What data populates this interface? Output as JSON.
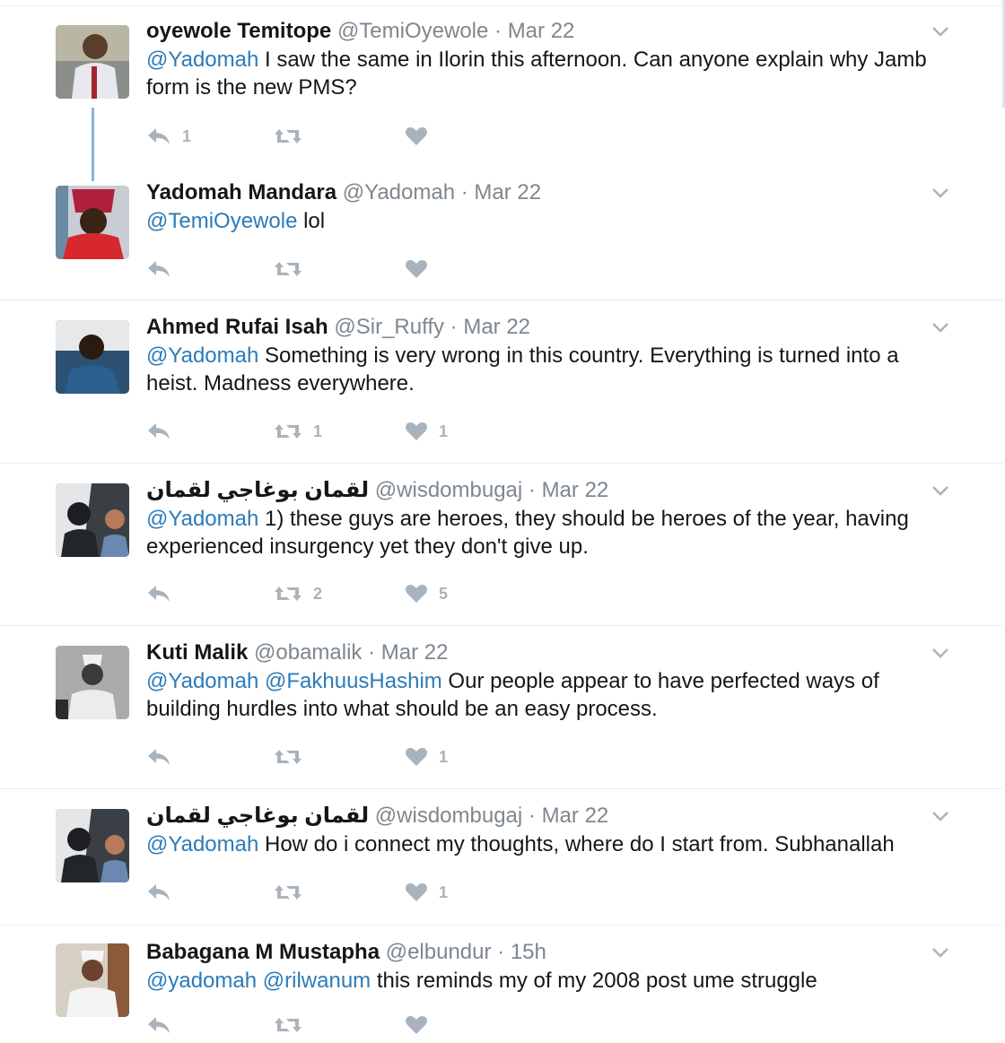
{
  "tweets": [
    {
      "name": "oyewole Temitope",
      "handle": "@TemiOyewole",
      "time": "· Mar 22",
      "parts": [
        {
          "text": "@Yadomah",
          "mention": true
        },
        {
          "text": " I saw the same in Ilorin this afternoon. Can anyone explain why Jamb form is the new PMS?",
          "mention": false
        }
      ],
      "reply_count": "1",
      "retweet_count": "",
      "like_count": ""
    },
    {
      "name": "Yadomah Mandara",
      "handle": "@Yadomah",
      "time": "· Mar 22",
      "parts": [
        {
          "text": "@TemiOyewole",
          "mention": true
        },
        {
          "text": " lol",
          "mention": false
        }
      ],
      "reply_count": "",
      "retweet_count": "",
      "like_count": ""
    },
    {
      "name": "Ahmed Rufai Isah",
      "handle": "@Sir_Ruffy",
      "time": "· Mar 22",
      "parts": [
        {
          "text": "@Yadomah",
          "mention": true
        },
        {
          "text": " Something is very wrong in this country. Everything is turned into a heist. Madness everywhere.",
          "mention": false
        }
      ],
      "reply_count": "",
      "retweet_count": "1",
      "like_count": "1"
    },
    {
      "name": "لقمان بوغاجي لقمان",
      "handle": "@wisdombugaj",
      "time": "· Mar 22",
      "parts": [
        {
          "text": "@Yadomah",
          "mention": true
        },
        {
          "text": " 1) these guys are heroes, they should be heroes of the year, having experienced insurgency yet they don't give up.",
          "mention": false
        }
      ],
      "reply_count": "",
      "retweet_count": "2",
      "like_count": "5"
    },
    {
      "name": "Kuti Malik",
      "handle": "@obamalik",
      "time": "· Mar 22",
      "parts": [
        {
          "text": "@Yadomah",
          "mention": true
        },
        {
          "text": " ",
          "mention": false
        },
        {
          "text": "@FakhuusHashim",
          "mention": true
        },
        {
          "text": " Our people appear to have perfected ways of building hurdles into what should be an easy process.",
          "mention": false
        }
      ],
      "reply_count": "",
      "retweet_count": "",
      "like_count": "1"
    },
    {
      "name": "لقمان بوغاجي لقمان",
      "handle": "@wisdombugaj",
      "time": "· Mar 22",
      "parts": [
        {
          "text": "@Yadomah",
          "mention": true
        },
        {
          "text": " How do i connect my thoughts, where do I start from. Subhanallah",
          "mention": false
        }
      ],
      "reply_count": "",
      "retweet_count": "",
      "like_count": "1"
    },
    {
      "name": "Babagana M Mustapha",
      "handle": "@elbundur",
      "time": "· 15h",
      "parts": [
        {
          "text": "@yadomah",
          "mention": true
        },
        {
          "text": " ",
          "mention": false
        },
        {
          "text": "@rilwanum",
          "mention": true
        },
        {
          "text": " this reminds my of my 2008 post ume struggle",
          "mention": false
        }
      ],
      "reply_count": "",
      "retweet_count": "",
      "like_count": ""
    }
  ],
  "colors": {
    "mention": "#2b7bb9",
    "meta": "#7d8790",
    "icon": "#a8b3bd",
    "thread_line": "#8ab6d6",
    "divider": "#e6ecf0"
  },
  "icons": {
    "reply": "reply-icon",
    "retweet": "retweet-icon",
    "like": "heart-icon",
    "menu": "chevron-down-icon"
  }
}
